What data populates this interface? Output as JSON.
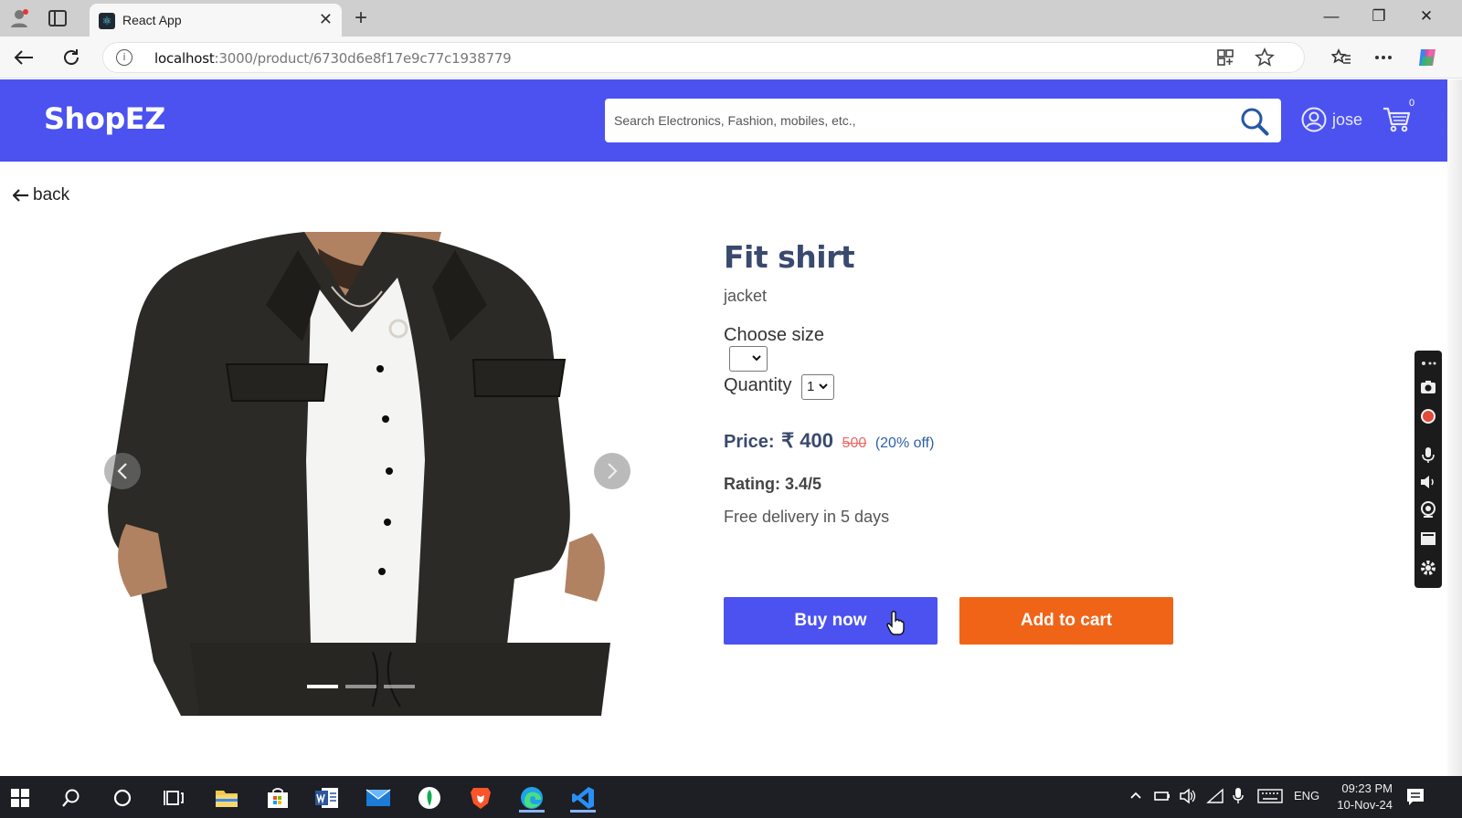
{
  "browser": {
    "tab_title": "React App",
    "url_host": "localhost",
    "url_path": ":3000/product/6730d6e8f17e9c77c1938779"
  },
  "header": {
    "brand": "ShopEZ",
    "search_placeholder": "Search Electronics, Fashion, mobiles, etc.,",
    "username": "jose",
    "cart_count": "0"
  },
  "nav": {
    "back_label": "back"
  },
  "product": {
    "title": "Fit shirt",
    "category": "jacket",
    "size_label": "Choose size",
    "size_value": "",
    "quantity_label": "Quantity",
    "quantity_value": "1",
    "price_label": "Price:",
    "price_value": "₹ 400",
    "mrp": "500",
    "discount": "(20% off)",
    "rating": "Rating: 3.4/5",
    "delivery": "Free delivery in 5 days",
    "carousel_slides": 3,
    "active_slide": 1
  },
  "actions": {
    "buy_now": "Buy now",
    "add_to_cart": "Add to cart"
  },
  "taskbar": {
    "language": "ENG",
    "time": "09:23 PM",
    "date": "10-Nov-24"
  },
  "colors": {
    "primary": "#4b52f0",
    "accent": "#f06418",
    "title": "#3a4a6e"
  }
}
